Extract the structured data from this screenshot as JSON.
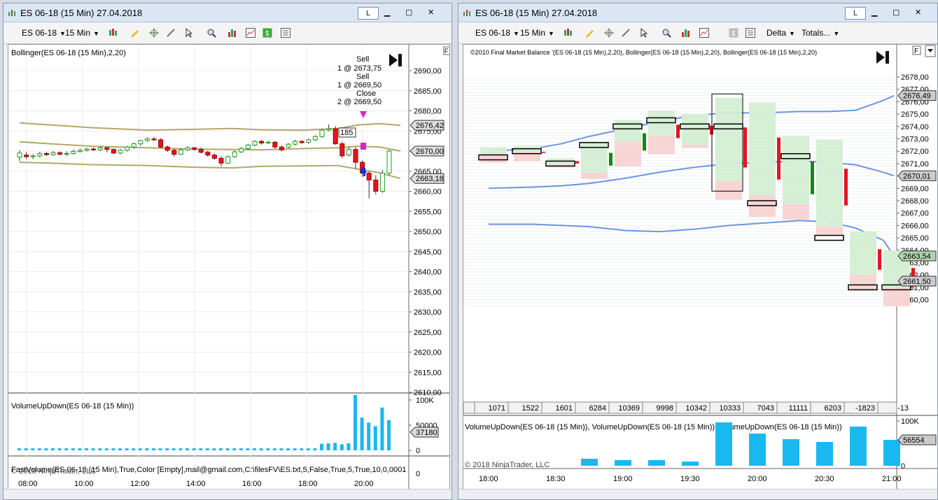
{
  "left": {
    "title": "ES 06-18 (15 Min)  27.04.2018",
    "l_button": "L",
    "toolbar": {
      "instrument": "ES 06-18",
      "interval": "15 Min"
    },
    "indicator_label": "Bollinger(ES 06-18 (15 Min),2,20)",
    "f_label": "F",
    "trade_annotations": [
      "Sell",
      "1 @ 2673,75",
      "Sell",
      "1 @ 2669,50",
      "Close",
      "2 @ 2669,50"
    ],
    "position_marker": "185",
    "price_axis": [
      "2690,00",
      "2685,00",
      "2680,00",
      "2675,00",
      "2670,00",
      "2665,00",
      "2660,00",
      "2655,00",
      "2650,00",
      "2645,00",
      "2640,00",
      "2635,00",
      "2630,00",
      "2625,00",
      "2620,00",
      "2615,00",
      "2610,00"
    ],
    "price_tags": [
      "2676,42",
      "2670,00",
      "2663,18"
    ],
    "volume_label": "VolumeUpDown(ES 06-18 (15 Min))",
    "volume_axis": [
      "100K",
      "50000",
      "0"
    ],
    "volume_tag": "37180",
    "bottom_label": "FastVolume(ES 06-18 (15 Min),True,Color [Empty],mail@gmail.com,C:\\filesFV\\ES.txt,5,False,True,5,True,10,0,0001",
    "bottom_axis": "0",
    "copyright": "© 2018 NinjaTrader, LLC",
    "time_axis": [
      "08:00",
      "10:00",
      "12:00",
      "14:00",
      "16:00",
      "18:00",
      "20:00"
    ]
  },
  "right": {
    "title": "ES 06-18 (15 Min)  27.04.2018",
    "l_button": "L",
    "toolbar": {
      "instrument": "ES 06-18",
      "interval": "15 Min",
      "delta": "Delta",
      "totals": "Totals..."
    },
    "indicator_label": "©2010 Final Market Balance  '(ES 06-18 (15 Min),2,20), Bollinger(ES 06-18 (15 Min),2,20), Bollinger(ES 06-18 (15 Min),2,20)",
    "f_label": "F",
    "price_axis": [
      "2678,00",
      "2677,00",
      "2676,00",
      "2675,00",
      "2674,00",
      "2673,00",
      "2672,00",
      "2671,00",
      "2670,00",
      "2669,00",
      "2668,00",
      "2667,00",
      "2666,00",
      "2665,00",
      "2664,00",
      "2663,00",
      "2662,00",
      "2661,00",
      "2660,00"
    ],
    "price_tags": [
      "2676,49",
      "2670,01",
      "2663,54",
      "2661,50"
    ],
    "totals_row": [
      "1071",
      "1522",
      "1601",
      "6284",
      "10369",
      "9998",
      "10342",
      "10333",
      "7043",
      "11111",
      "6203",
      "-1823",
      "-13"
    ],
    "volume_label": "VolumeUpDown(ES 06-18 (15 Min)), VolumeUpDown(ES 06-18 (15 Min)), VolumeUpDown(ES 06-18 (15 Min))",
    "volume_axis": [
      "100K",
      "0"
    ],
    "volume_tag": "56554",
    "copyright": "© 2018 NinjaTrader, LLC",
    "time_axis": [
      "18:00",
      "18:30",
      "19:00",
      "19:30",
      "20:00",
      "20:30",
      "21:00"
    ]
  },
  "colors": {
    "up": "#1e9e1e",
    "down": "#e8141e",
    "band": "#b5a66a",
    "blue_band": "#6b95e0",
    "volume": "#1ab8f0"
  }
}
